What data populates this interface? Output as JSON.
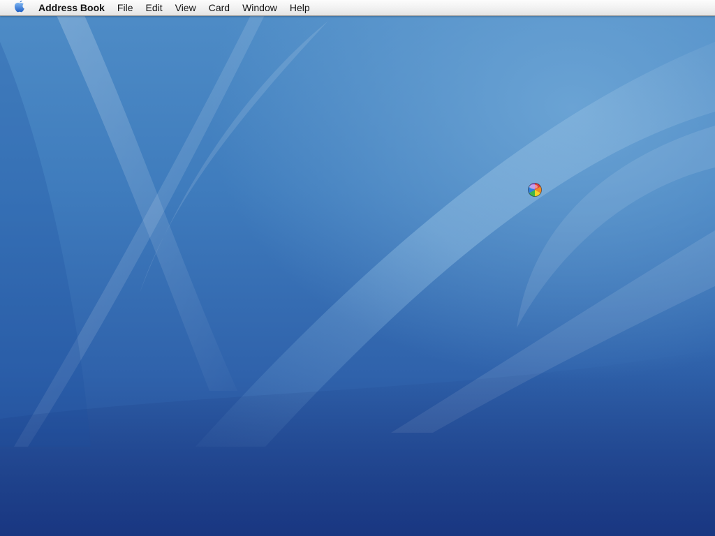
{
  "menubar": {
    "apple_icon": "apple-logo-icon",
    "app_name": "Address Book",
    "items": [
      {
        "label": "File"
      },
      {
        "label": "Edit"
      },
      {
        "label": "View"
      },
      {
        "label": "Card"
      },
      {
        "label": "Window"
      },
      {
        "label": "Help"
      }
    ]
  },
  "desktop": {
    "wallpaper": "aqua-blue",
    "cursor_icon": "spinning-wait-cursor-icon"
  },
  "colors": {
    "menubar_bg": "#f1f1f1",
    "wallpaper_top": "#4f8dc7",
    "wallpaper_bottom": "#1f3f8a",
    "apple_blue": "#3a7bd5"
  }
}
